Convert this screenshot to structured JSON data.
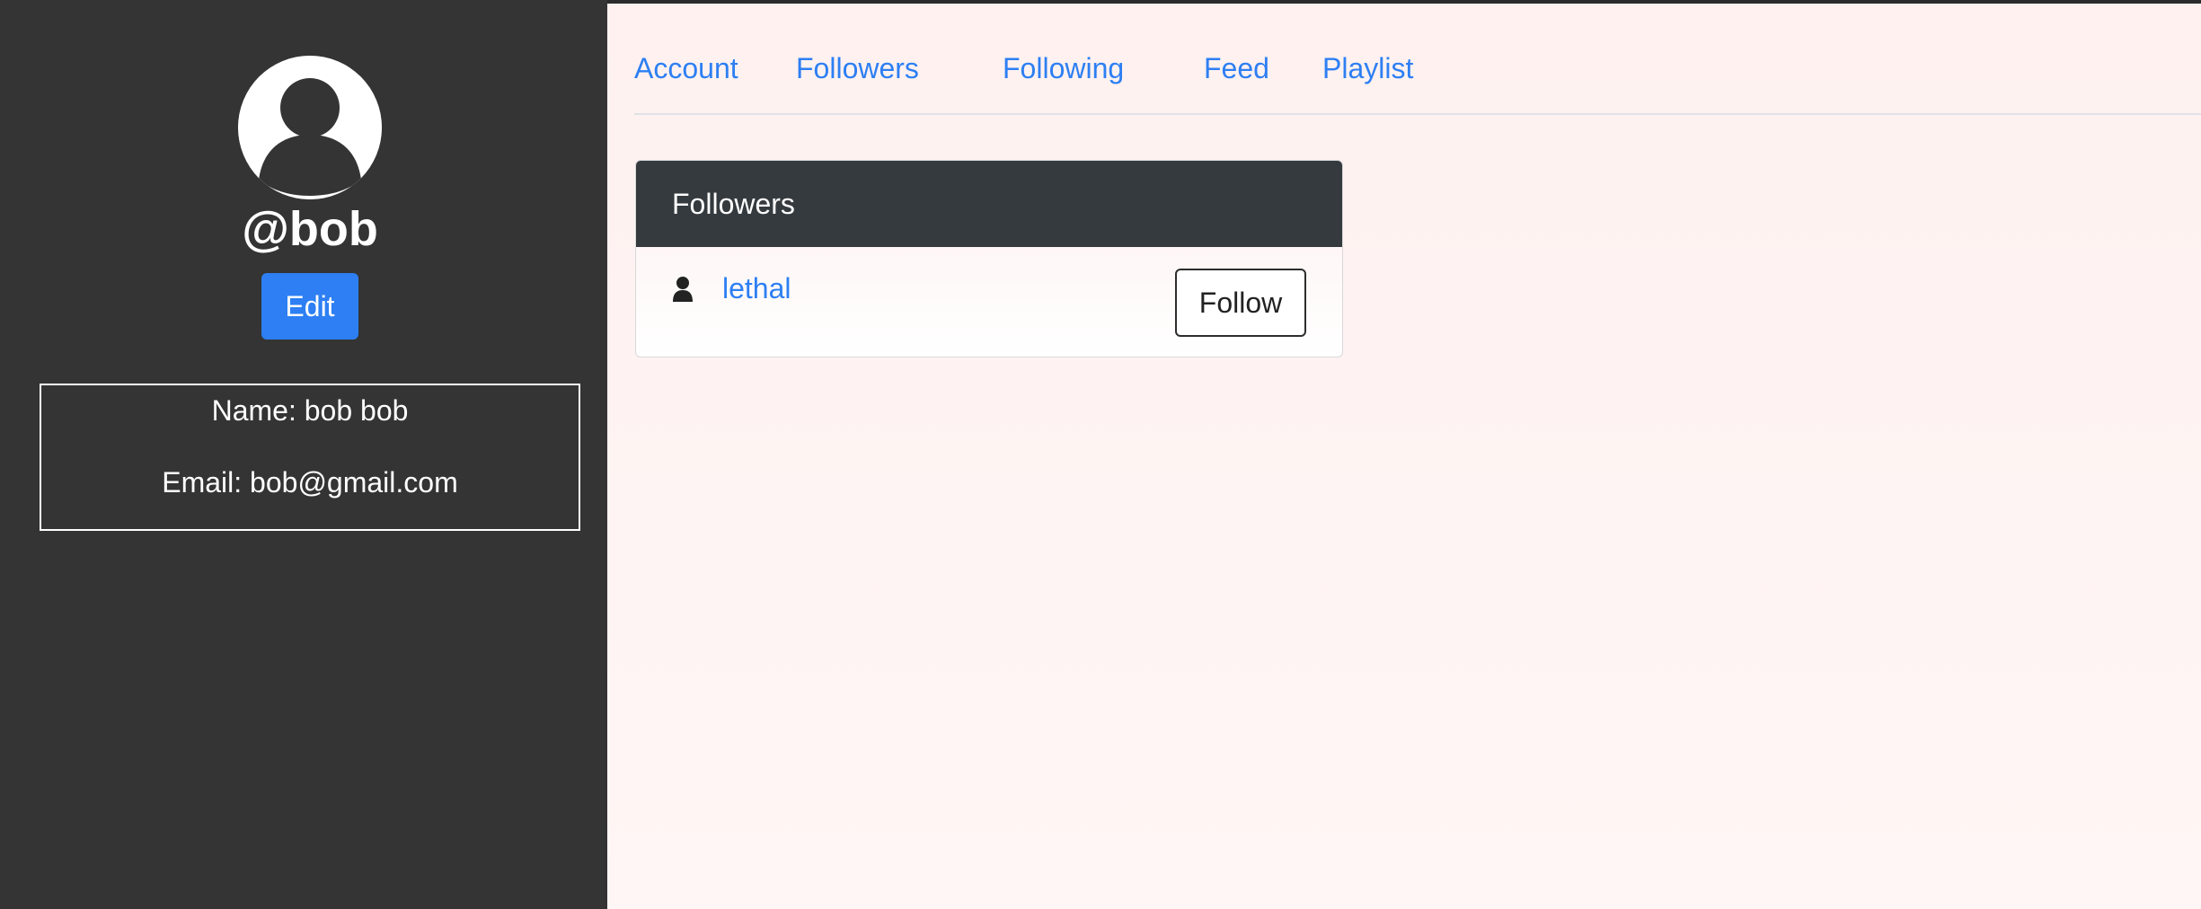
{
  "profile": {
    "username": "@bob",
    "edit_label": "Edit",
    "name_line": "Name: bob bob",
    "email_line": "Email: bob@gmail.com"
  },
  "nav": {
    "items": [
      {
        "label": "Account"
      },
      {
        "label": "Followers"
      },
      {
        "label": "Following"
      },
      {
        "label": "Feed"
      },
      {
        "label": "Playlist"
      }
    ]
  },
  "followers_card": {
    "title": "Followers",
    "rows": [
      {
        "user": "lethal",
        "action_label": "Follow"
      }
    ]
  },
  "icons": {
    "avatar": "user-circle-icon",
    "row": "person-icon"
  },
  "colors": {
    "sidebar": "#343434",
    "accent": "#2d7ff3",
    "card_header": "#353a3e",
    "main_background": "#fff5f4"
  }
}
